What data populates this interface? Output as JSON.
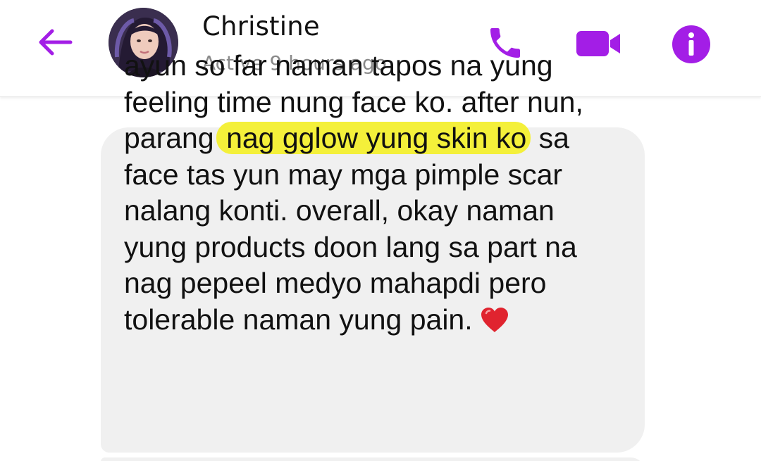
{
  "header": {
    "contact_name": "Christine",
    "status": "Active 9 hours ago",
    "back_icon": "back-arrow-icon",
    "actions": [
      {
        "name": "call",
        "icon": "phone-icon"
      },
      {
        "name": "video",
        "icon": "video-camera-icon"
      },
      {
        "name": "info",
        "icon": "info-icon"
      }
    ],
    "accent_color": "#a31ee6"
  },
  "message": {
    "lines": [
      {
        "text": "ayun so far naman tapos na yung"
      },
      {
        "text": "feeling time nung face ko. after nun,"
      },
      {
        "before": "parang ",
        "highlight": "nag gglow yung skin ko",
        "after": " sa"
      },
      {
        "text": "face tas yun may mga pimple scar"
      },
      {
        "text": "nalang konti. overall, okay naman"
      },
      {
        "text": "yung products doon lang sa part na"
      },
      {
        "text": "nag pepeel medyo mahapdi pero"
      },
      {
        "text": "tolerable naman yung pain.",
        "emoji": "heart-icon"
      }
    ],
    "bubble_color": "#f0f0f0",
    "highlight_color": "#f4f03a",
    "emoji_color": "#e0242f"
  }
}
